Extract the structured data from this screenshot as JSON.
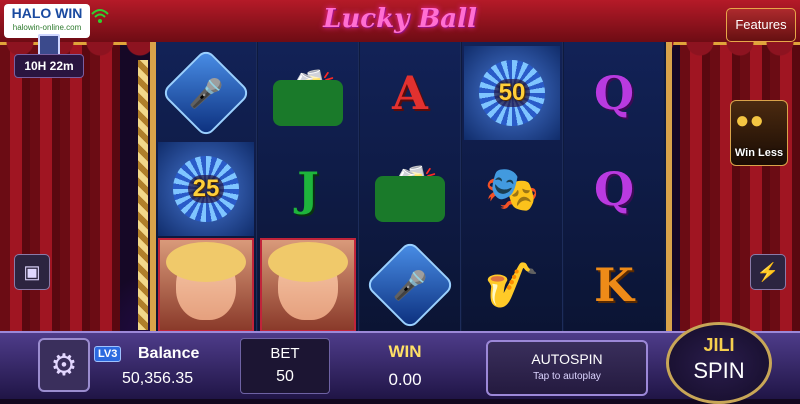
{
  "header": {
    "brand_name": "HALO WIN",
    "brand_site": "halowin-online.com",
    "timer": "10H 22m",
    "title": "Lucky Ball",
    "features_label": "Features"
  },
  "reels": [
    [
      {
        "type": "mic"
      },
      {
        "type": "ball",
        "value": "25"
      },
      {
        "type": "lady"
      }
    ],
    [
      {
        "type": "champagne"
      },
      {
        "type": "letter",
        "value": "J"
      },
      {
        "type": "lady"
      }
    ],
    [
      {
        "type": "letter",
        "value": "A"
      },
      {
        "type": "champagne"
      },
      {
        "type": "mic"
      }
    ],
    [
      {
        "type": "ball",
        "value": "50"
      },
      {
        "type": "mask"
      },
      {
        "type": "sax"
      }
    ],
    [
      {
        "type": "letter",
        "value": "Q"
      },
      {
        "type": "letter",
        "value": "Q"
      },
      {
        "type": "letter",
        "value": "K"
      }
    ]
  ],
  "promo": {
    "label": "Win Less"
  },
  "footer": {
    "level": "LV3",
    "balance_label": "Balance",
    "balance_value": "50,356.35",
    "bet_label": "BET",
    "bet_value": "50",
    "win_label": "WIN",
    "win_value": "0.00",
    "autospin_label": "AUTOSPIN",
    "autospin_sub": "Tap to autoplay",
    "spin_brand": "JILI",
    "spin_label": "SPIN"
  },
  "icons": {
    "settings": "gear-icon",
    "bag": "bag-icon",
    "flash": "lightning-icon",
    "wifi": "wifi-icon"
  }
}
